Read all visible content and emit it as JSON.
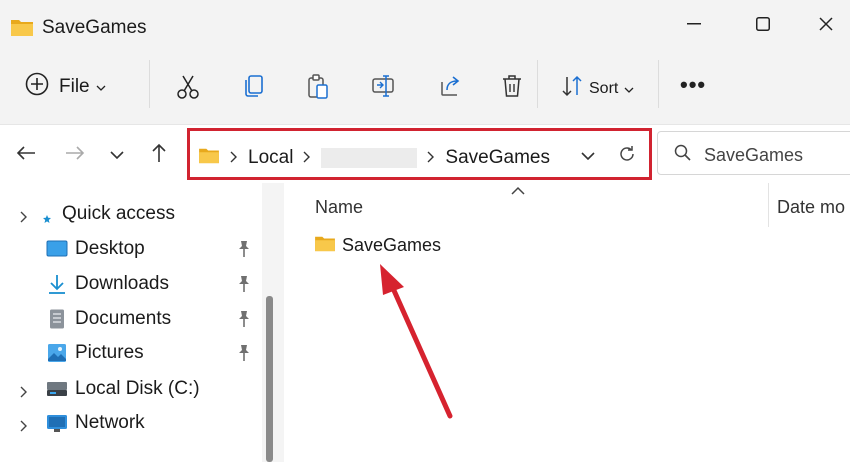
{
  "window": {
    "title": "SaveGames"
  },
  "toolbar": {
    "file_label": "File",
    "sort_label": "Sort",
    "more_label": "•••"
  },
  "address": {
    "crumbs": [
      "Local",
      "",
      "SaveGames"
    ]
  },
  "search": {
    "placeholder": "SaveGames"
  },
  "sidebar": {
    "items": [
      {
        "label": "Quick access",
        "icon": "star-icon",
        "pinned": false,
        "expandable": true
      },
      {
        "label": "Desktop",
        "icon": "desktop-icon",
        "pinned": true,
        "expandable": false
      },
      {
        "label": "Downloads",
        "icon": "download-icon",
        "pinned": true,
        "expandable": false
      },
      {
        "label": "Documents",
        "icon": "documents-icon",
        "pinned": true,
        "expandable": false
      },
      {
        "label": "Pictures",
        "icon": "pictures-icon",
        "pinned": true,
        "expandable": false
      },
      {
        "label": "Local Disk (C:)",
        "icon": "drive-icon",
        "pinned": false,
        "expandable": true
      },
      {
        "label": "Network",
        "icon": "network-icon",
        "pinned": false,
        "expandable": true
      }
    ]
  },
  "columns": {
    "name": "Name",
    "date": "Date mo"
  },
  "files": [
    {
      "name": "SaveGames",
      "icon": "folder-icon"
    }
  ],
  "colors": {
    "highlight": "#d12330",
    "folder": "#f5c343",
    "accent": "#0a63c9"
  }
}
